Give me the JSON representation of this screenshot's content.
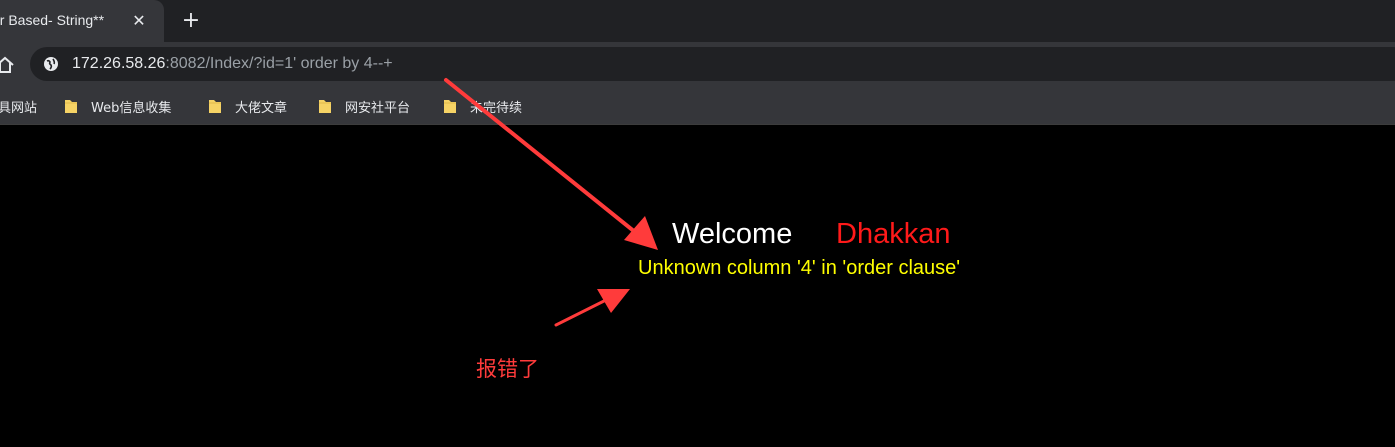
{
  "browser": {
    "tab": {
      "title": "or Based- String**",
      "close_glyph": "✕"
    },
    "new_tab_glyph": "+",
    "address": {
      "host": "172.26.58.26",
      "rest": ":8082/Index/?id=1' order by 4--+"
    },
    "bookmarks": [
      {
        "label": "具网站",
        "icon": "none"
      },
      {
        "label": "Web信息收集",
        "icon": "folder-icon"
      },
      {
        "label": "大佬文章",
        "icon": "folder-icon"
      },
      {
        "label": "网安社平台",
        "icon": "folder-icon"
      },
      {
        "label": "未完待续",
        "icon": "folder-icon"
      }
    ]
  },
  "page": {
    "welcome": "Welcome",
    "name": "Dhakkan",
    "error": "Unknown column '4' in 'order clause'"
  },
  "annotation": {
    "note": "报错了",
    "color": "#ff3b3b"
  }
}
